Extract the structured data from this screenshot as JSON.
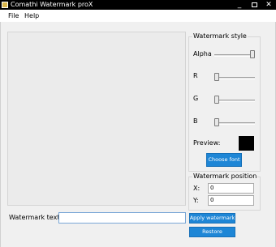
{
  "window": {
    "title": "Comathi Watermark proX",
    "controls": [
      "_",
      "□",
      "✕"
    ]
  },
  "menu": [
    "File",
    "Help"
  ],
  "watermark_style": {
    "title": "Watermark style",
    "sliders": [
      {
        "label": "Alpha",
        "value": 1.0
      },
      {
        "label": "R",
        "value": 0.0
      },
      {
        "label": "G",
        "value": 0.0
      },
      {
        "label": "B",
        "value": 0.0
      }
    ],
    "preview_label": "Preview:",
    "preview_color": "#000000",
    "choose_font": "Choose font"
  },
  "watermark_position": {
    "title": "Watermark position",
    "x_label": "X:",
    "x_value": "0",
    "y_label": "Y:",
    "y_value": "0"
  },
  "watermark_text": {
    "label": "Watermark text:",
    "value": ""
  },
  "buttons": {
    "apply": "Apply watermark",
    "restore": "Restore"
  },
  "colors": {
    "accent": "#1e86d6",
    "titlebar": "#000000",
    "panel": "#f0f0f0"
  }
}
